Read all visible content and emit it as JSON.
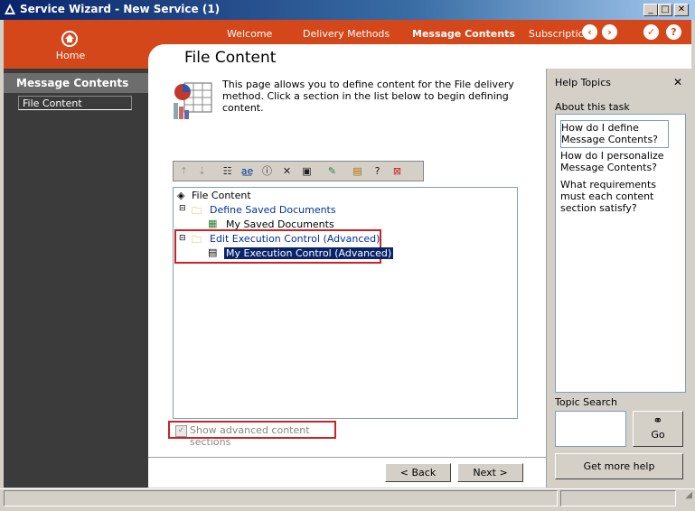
{
  "window": {
    "title": "Service Wizard - New Service (1)",
    "minimize": "_",
    "maximize": "□",
    "close": "✕"
  },
  "header": {
    "home_label": "Home",
    "tabs": [
      {
        "label": "Welcome",
        "active": false
      },
      {
        "label": "Delivery Methods",
        "active": false
      },
      {
        "label": "Message Contents",
        "active": true
      },
      {
        "label": "Subscriptic",
        "active": false
      }
    ],
    "back_arrow": "‹",
    "forward_arrow": "›",
    "check": "✓",
    "help": "?"
  },
  "sidebar": {
    "section": "Message Contents",
    "items": [
      {
        "label": "File Content"
      }
    ]
  },
  "main": {
    "page_title": "File Content",
    "description": "This page allows you to define content for the File delivery method. Click a section in the list below to begin defining content.",
    "tree": {
      "root": "File Content",
      "nodes": [
        {
          "label": "Define Saved Documents",
          "children": [
            "My Saved Documents"
          ]
        },
        {
          "label": "Edit Execution Control (Advanced)",
          "children": [
            "My Execution Control (Advanced)"
          ]
        }
      ]
    },
    "checkbox_label": "Show advanced content sections",
    "back_button": "< Back",
    "next_button": "Next >"
  },
  "help": {
    "title": "Help Topics",
    "close": "✕",
    "about": "About this task",
    "items": [
      "How do I define Message Contents?",
      "How do I personalize Message Contents?",
      "What requirements must each content section satisfy?"
    ],
    "search_label": "Topic Search",
    "go": "Go",
    "more": "Get more help"
  },
  "colors": {
    "accent": "#d4471a",
    "sidebar": "#3b3b3b",
    "selection": "#0a246a",
    "highlight_box": "#cc2222"
  }
}
